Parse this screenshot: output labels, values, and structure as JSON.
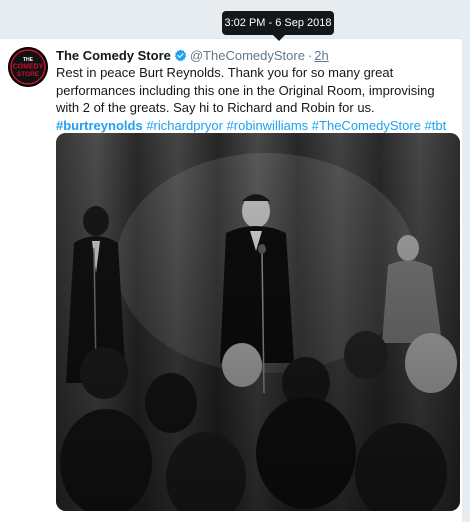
{
  "tooltip": {
    "timestamp": "3:02 PM - 6 Sep 2018"
  },
  "tweet": {
    "author_name": "The Comedy Store",
    "handle": "@TheComedyStore",
    "separator": "·",
    "relative_time": "2h",
    "text": "Rest in peace Burt Reynolds. Thank you for so many great performances including this one in the Original Room, improvising with 2 of the greats. Say hi to Richard and Robin for us.",
    "hashtags": [
      "#burtreynolds",
      "#richardpryor",
      "#robinwilliams",
      "#TheComedyStore",
      "#tbt"
    ]
  },
  "avatar": {
    "logo_text": [
      "THE",
      "COMEDY",
      "STORE"
    ]
  },
  "colors": {
    "link": "#1da1f2",
    "text": "#14171a",
    "muted": "#657786",
    "tooltip_bg": "#14171a",
    "card_bg": "#ffffff",
    "page_bg": "#e6ecf0",
    "logo_red": "#c8102e"
  },
  "icons": {
    "verified": "verified-badge-icon"
  }
}
